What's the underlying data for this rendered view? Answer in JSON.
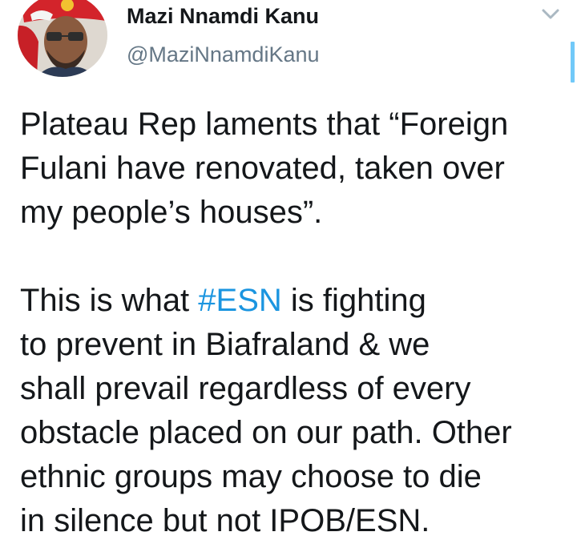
{
  "tweet": {
    "author": {
      "display_name": "Mazi Nnamdi Kanu",
      "handle": "@MaziNnamdiKanu",
      "avatar_icon": "profile-photo"
    },
    "menu_icon": "chevron-down-icon",
    "paragraph1": [
      "Plateau Rep laments that “Foreign",
      "Fulani have renovated, taken over",
      "my people’s houses”."
    ],
    "paragraph2": {
      "line1_prefix": "This is what ",
      "hashtag": "#ESN",
      "line1_suffix": " is fighting",
      "lines": [
        "to prevent in Biafraland & we",
        "shall prevail regardless of every",
        "obstacle placed on our path. Other",
        "ethnic groups may choose to die",
        "in silence but not IPOB/ESN."
      ]
    },
    "colors": {
      "text": "#14171a",
      "handle": "#657786",
      "hashtag": "#1b95e0",
      "scroll_indicator": "#71c9f8"
    }
  }
}
